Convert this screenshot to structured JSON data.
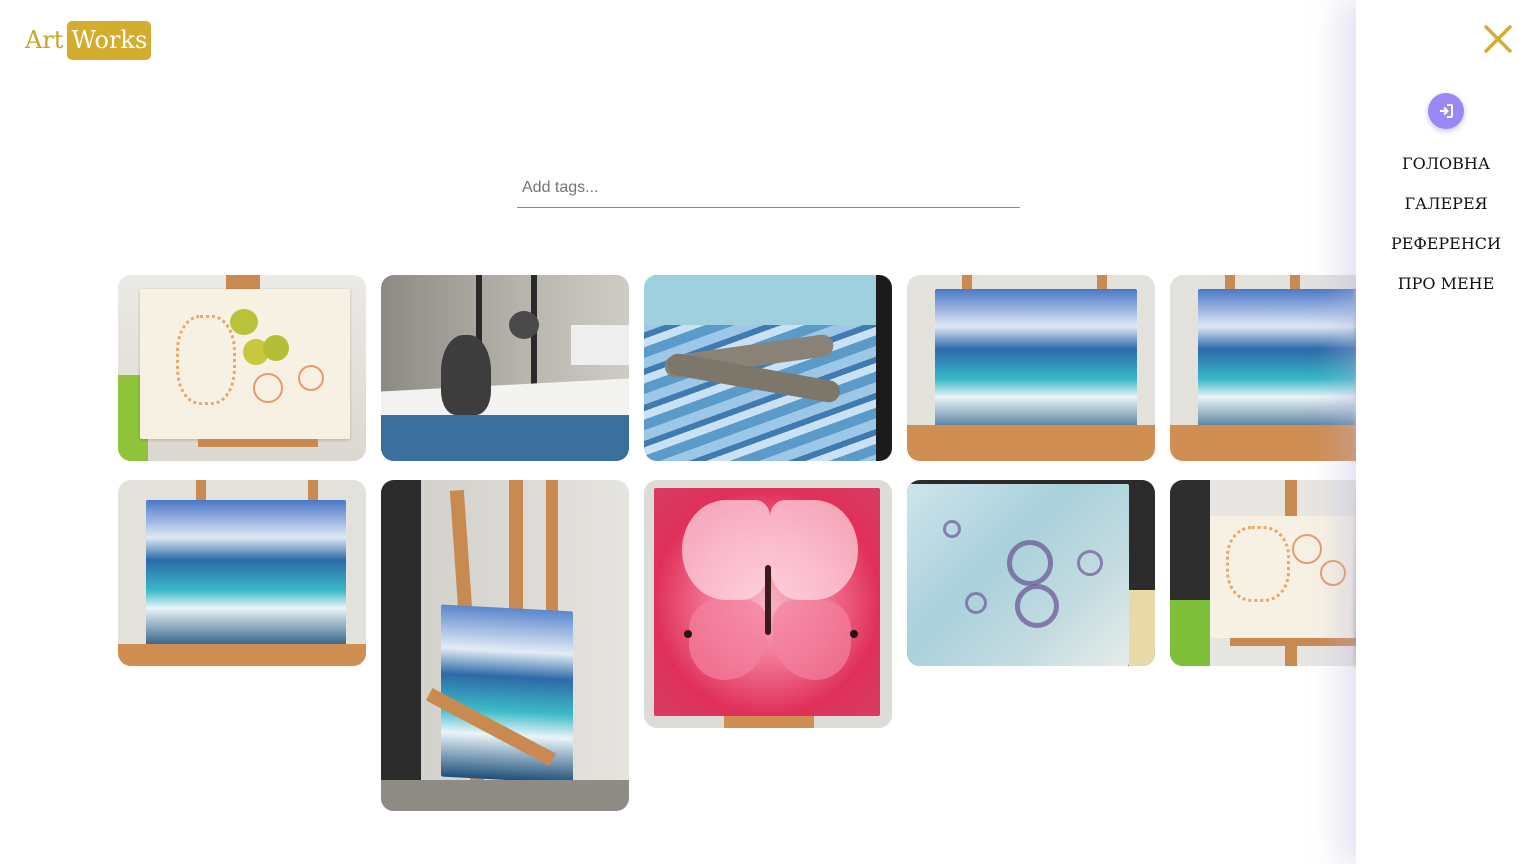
{
  "logo": {
    "part1": "Art",
    "part2": "Works"
  },
  "search": {
    "placeholder": "Add tags...",
    "value": ""
  },
  "sidebar": {
    "nav": [
      {
        "label": "ГОЛОВНА"
      },
      {
        "label": "ГАЛЕРЕЯ"
      },
      {
        "label": "РЕФЕРЕНСИ"
      },
      {
        "label": "ПРО МЕНЕ"
      }
    ]
  },
  "gallery": {
    "items": [
      {
        "subject": "still-life sketch with quinces on easel"
      },
      {
        "subject": "gray kitten on windowsill"
      },
      {
        "subject": "two tabby kittens sleeping on striped blanket"
      },
      {
        "subject": "ocean wave painting on easel"
      },
      {
        "subject": "ocean wave painting on easel"
      },
      {
        "subject": "ocean wave painting on easel"
      },
      {
        "subject": "ocean wave painting on tall easel"
      },
      {
        "subject": "pink butterfly painting"
      },
      {
        "subject": "blue abstract bubbles painting"
      },
      {
        "subject": "still-life sketch with fruit on easel"
      }
    ]
  },
  "colors": {
    "accent": "#d4ad2e",
    "login": "#9b87f5"
  }
}
